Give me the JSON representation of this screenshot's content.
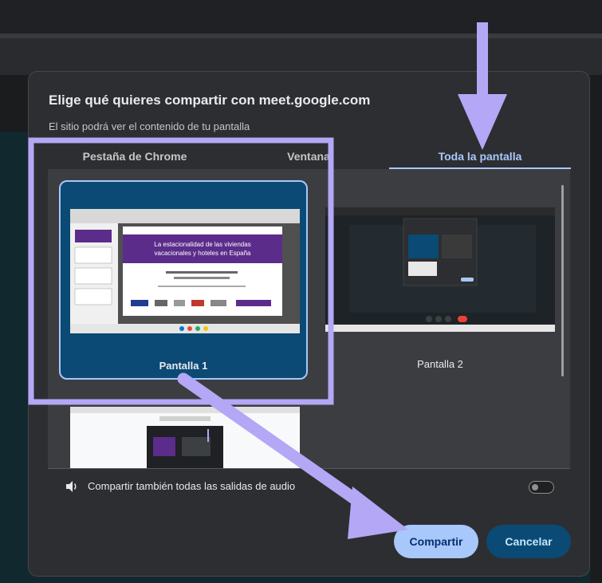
{
  "dialog": {
    "title": "Elige qué quieres compartir con meet.google.com",
    "subtitle": "El sitio podrá ver el contenido de tu pantalla"
  },
  "tabs": [
    {
      "label": "Pestaña de Chrome",
      "active": false
    },
    {
      "label": "Ventana",
      "active": false
    },
    {
      "label": "Toda la pantalla",
      "active": true
    }
  ],
  "screens": [
    {
      "label": "Pantalla 1",
      "selected": true
    },
    {
      "label": "Pantalla 2",
      "selected": false
    }
  ],
  "thumbnail": {
    "slide_title": "La estacionalidad de las viviendas vacacionales y hoteles en España"
  },
  "audio": {
    "label": "Compartir también todas las salidas de audio",
    "enabled": false
  },
  "buttons": {
    "share": "Compartir",
    "cancel": "Cancelar"
  },
  "colors": {
    "accent": "#a8c7fa",
    "selected_card": "#0b4a74",
    "annotation": "#b4a7f5"
  }
}
